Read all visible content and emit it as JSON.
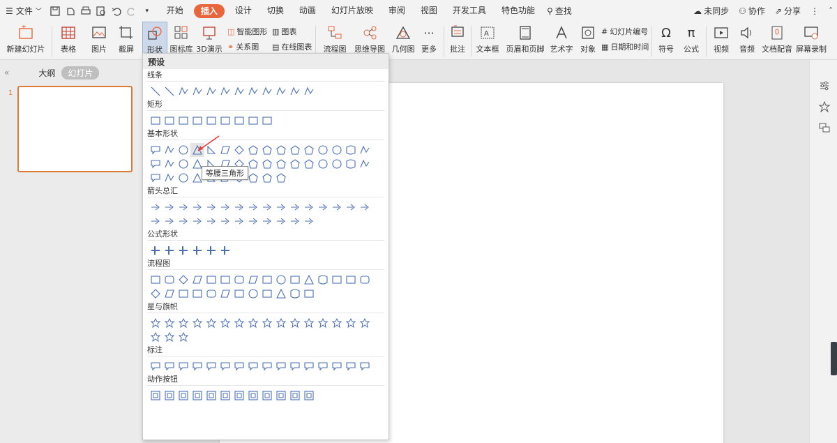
{
  "menubar": {
    "file": "文件",
    "tabs": [
      "开始",
      "插入",
      "设计",
      "切换",
      "动画",
      "幻灯片放映",
      "审阅",
      "视图",
      "开发工具",
      "特色功能"
    ],
    "active_tab": "插入",
    "search": "查找",
    "right": {
      "sync": "未同步",
      "collab": "协作",
      "share": "分享"
    }
  },
  "ribbon": {
    "new_slide": "新建幻灯片",
    "table": "表格",
    "picture": "图片",
    "screenshot": "截屏",
    "shape": "形状",
    "icon_lib": "图标库",
    "three_d": "3D演示",
    "smart_art": "智能图形",
    "chart": "图表",
    "relation": "关系图",
    "online_chart": "在线图表",
    "flowchart": "流程图",
    "mindmap": "思维导图",
    "geometry": "几何图",
    "more": "更多",
    "comment": "批注",
    "textbox": "文本框",
    "header_footer": "页眉和页脚",
    "wordart": "艺术字",
    "object": "对象",
    "slide_num": "幻灯片编号",
    "datetime": "日期和时间",
    "symbol": "符号",
    "formula": "公式",
    "video": "视频",
    "audio": "音频",
    "doc_voice": "文档配音",
    "screen_record": "屏幕录制"
  },
  "left_panel": {
    "outline": "大纲",
    "slides": "幻灯片",
    "slide_number": "1"
  },
  "shape_menu": {
    "header": "预设",
    "sections": [
      {
        "title": "线条",
        "count": 12
      },
      {
        "title": "矩形",
        "count": 9
      },
      {
        "title": "基本形状",
        "count": 42
      },
      {
        "title": "箭头总汇",
        "count": 28
      },
      {
        "title": "公式形状",
        "count": 6
      },
      {
        "title": "流程图",
        "count": 28
      },
      {
        "title": "星与旗帜",
        "count": 19
      },
      {
        "title": "标注",
        "count": 16
      },
      {
        "title": "动作按钮",
        "count": 12
      }
    ],
    "tooltip": "等腰三角形"
  },
  "colors": {
    "accent": "#e8663c",
    "shape_stroke": "#4a6fb5",
    "thumb_border": "#e07b35"
  }
}
